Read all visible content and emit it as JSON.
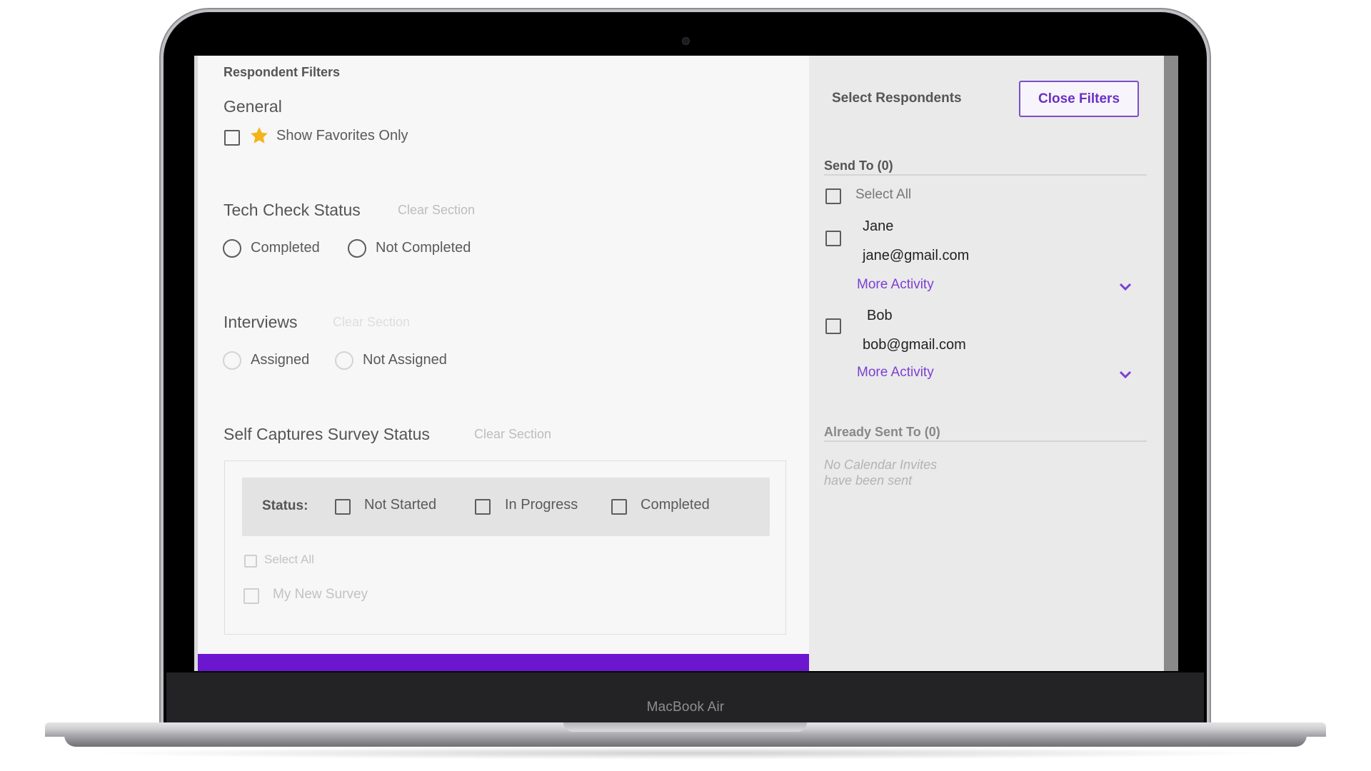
{
  "device": {
    "brand": "MacBook Air"
  },
  "filters": {
    "title": "Respondent Filters",
    "general": {
      "title": "General",
      "favorites_label": "Show Favorites Only"
    },
    "tech_check": {
      "title": "Tech Check Status",
      "clear": "Clear Section",
      "options": [
        "Completed",
        "Not Completed"
      ]
    },
    "interviews": {
      "title": "Interviews",
      "clear": "Clear Section",
      "options": [
        "Assigned",
        "Not Assigned"
      ]
    },
    "self_capture": {
      "title": "Self Captures Survey Status",
      "clear": "Clear Section",
      "status_label": "Status:",
      "status_options": [
        "Not Started",
        "In Progress",
        "Completed"
      ],
      "select_all": "Select All",
      "surveys": [
        "My New Survey"
      ]
    }
  },
  "respondents": {
    "title": "Select Respondents",
    "close_button": "Close Filters",
    "send_to": {
      "title": "Send To (0)",
      "select_all": "Select All",
      "people": [
        {
          "name": "Jane",
          "email": "jane@gmail.com",
          "more": "More Activity"
        },
        {
          "name": "Bob",
          "email": "bob@gmail.com",
          "more": "More Activity"
        }
      ]
    },
    "already_sent": {
      "title": "Already Sent To (0)",
      "empty_line1": "No Calendar Invites",
      "empty_line2": "have been sent"
    }
  },
  "colors": {
    "accent": "#7c3fd4",
    "purple_bar": "#6c16cf",
    "star": "#f4b41a"
  }
}
